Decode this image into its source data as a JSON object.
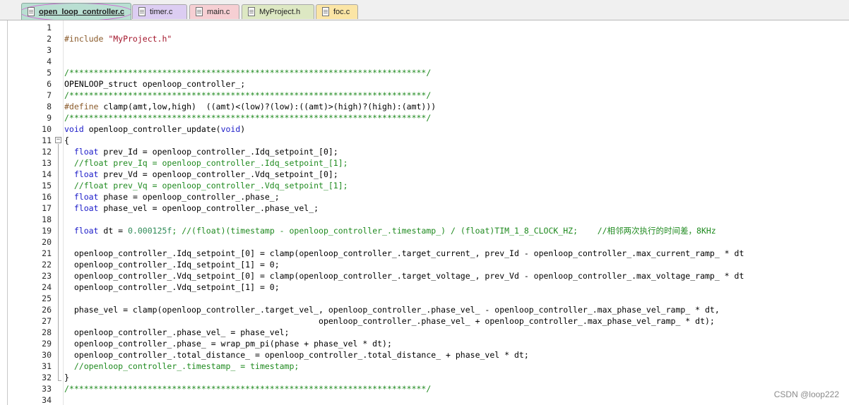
{
  "tabs": [
    {
      "label": "open_loop_controller.c",
      "active": true,
      "color": "#b9dfd2"
    },
    {
      "label": "timer.c",
      "active": false,
      "color": "#dccdf2"
    },
    {
      "label": "main.c",
      "active": false,
      "color": "#f6cfd3"
    },
    {
      "label": "MyProject.h",
      "active": false,
      "color": "#dde8c3"
    },
    {
      "label": "foc.c",
      "active": false,
      "color": "#fbe5a5"
    }
  ],
  "code_lines": [
    {
      "n": "1",
      "segments": []
    },
    {
      "n": "2",
      "segments": [
        {
          "t": "#include ",
          "c": "pre"
        },
        {
          "t": "\"MyProject.h\"",
          "c": "str"
        }
      ]
    },
    {
      "n": "3",
      "segments": []
    },
    {
      "n": "4",
      "segments": []
    },
    {
      "n": "5",
      "segments": [
        {
          "t": "/*************************************************************************/",
          "c": "com"
        }
      ]
    },
    {
      "n": "6",
      "segments": [
        {
          "t": "OPENLOOP_struct openloop_controller_;",
          "c": ""
        }
      ]
    },
    {
      "n": "7",
      "segments": [
        {
          "t": "/*************************************************************************/",
          "c": "com"
        }
      ]
    },
    {
      "n": "8",
      "segments": [
        {
          "t": "#define ",
          "c": "pre"
        },
        {
          "t": "clamp(amt,low,high)  ((amt)<(low)?(low):((amt)>(high)?(high):(amt)))",
          "c": ""
        }
      ]
    },
    {
      "n": "9",
      "segments": [
        {
          "t": "/*************************************************************************/",
          "c": "com"
        }
      ]
    },
    {
      "n": "10",
      "segments": [
        {
          "t": "void",
          "c": "kw"
        },
        {
          "t": " openloop_controller_update(",
          "c": ""
        },
        {
          "t": "void",
          "c": "kw"
        },
        {
          "t": ")",
          "c": ""
        }
      ]
    },
    {
      "n": "11",
      "segments": [
        {
          "t": "{",
          "c": ""
        }
      ]
    },
    {
      "n": "12",
      "segments": [
        {
          "t": "  ",
          "c": ""
        },
        {
          "t": "float",
          "c": "kw"
        },
        {
          "t": " prev_Id = openloop_controller_.Idq_setpoint_[0];",
          "c": ""
        }
      ]
    },
    {
      "n": "13",
      "segments": [
        {
          "t": "  //float prev_Iq = openloop_controller_.Idq_setpoint_[1];",
          "c": "com"
        }
      ]
    },
    {
      "n": "14",
      "segments": [
        {
          "t": "  ",
          "c": ""
        },
        {
          "t": "float",
          "c": "kw"
        },
        {
          "t": " prev_Vd = openloop_controller_.Vdq_setpoint_[0];",
          "c": ""
        }
      ]
    },
    {
      "n": "15",
      "segments": [
        {
          "t": "  //float prev_Vq = openloop_controller_.Vdq_setpoint_[1];",
          "c": "com"
        }
      ]
    },
    {
      "n": "16",
      "segments": [
        {
          "t": "  ",
          "c": ""
        },
        {
          "t": "float",
          "c": "kw"
        },
        {
          "t": " phase = openloop_controller_.phase_;",
          "c": ""
        }
      ]
    },
    {
      "n": "17",
      "segments": [
        {
          "t": "  ",
          "c": ""
        },
        {
          "t": "float",
          "c": "kw"
        },
        {
          "t": " phase_vel = openloop_controller_.phase_vel_;",
          "c": ""
        }
      ]
    },
    {
      "n": "18",
      "segments": []
    },
    {
      "n": "19",
      "segments": [
        {
          "t": "  ",
          "c": ""
        },
        {
          "t": "float",
          "c": "kw"
        },
        {
          "t": " dt = ",
          "c": ""
        },
        {
          "t": "0.000125f",
          "c": "num"
        },
        {
          "t": "; //(float)(timestamp - openloop_controller_.timestamp_) / (float)TIM_1_8_CLOCK_HZ;    //相邻两次执行的时间差，8KHz",
          "c": "com"
        }
      ]
    },
    {
      "n": "20",
      "segments": []
    },
    {
      "n": "21",
      "segments": [
        {
          "t": "  openloop_controller_.Idq_setpoint_[0] = clamp(openloop_controller_.target_current_, prev_Id - openloop_controller_.max_current_ramp_ * dt",
          "c": ""
        }
      ]
    },
    {
      "n": "22",
      "segments": [
        {
          "t": "  openloop_controller_.Idq_setpoint_[1] = 0;",
          "c": ""
        }
      ]
    },
    {
      "n": "23",
      "segments": [
        {
          "t": "  openloop_controller_.Vdq_setpoint_[0] = clamp(openloop_controller_.target_voltage_, prev_Vd - openloop_controller_.max_voltage_ramp_ * dt",
          "c": ""
        }
      ]
    },
    {
      "n": "24",
      "segments": [
        {
          "t": "  openloop_controller_.Vdq_setpoint_[1] = 0;",
          "c": ""
        }
      ]
    },
    {
      "n": "25",
      "segments": []
    },
    {
      "n": "26",
      "segments": [
        {
          "t": "  phase_vel = clamp(openloop_controller_.target_vel_, openloop_controller_.phase_vel_ - openloop_controller_.max_phase_vel_ramp_ * dt,",
          "c": ""
        }
      ]
    },
    {
      "n": "27",
      "segments": [
        {
          "t": "                                                    openloop_controller_.phase_vel_ + openloop_controller_.max_phase_vel_ramp_ * dt);",
          "c": ""
        }
      ]
    },
    {
      "n": "28",
      "segments": [
        {
          "t": "  openloop_controller_.phase_vel_ = phase_vel;",
          "c": ""
        }
      ]
    },
    {
      "n": "29",
      "segments": [
        {
          "t": "  openloop_controller_.phase_ = wrap_pm_pi(phase + phase_vel * dt);",
          "c": ""
        }
      ]
    },
    {
      "n": "30",
      "segments": [
        {
          "t": "  openloop_controller_.total_distance_ = openloop_controller_.total_distance_ + phase_vel * dt;",
          "c": ""
        }
      ]
    },
    {
      "n": "31",
      "segments": [
        {
          "t": "  //openloop_controller_.timestamp_ = timestamp;",
          "c": "com"
        }
      ]
    },
    {
      "n": "32",
      "segments": [
        {
          "t": "}",
          "c": ""
        }
      ]
    },
    {
      "n": "33",
      "segments": [
        {
          "t": "/*************************************************************************/",
          "c": "com"
        }
      ]
    },
    {
      "n": "34",
      "segments": []
    }
  ],
  "watermark": "CSDN @loop222",
  "fold_marker": "−",
  "icons": {
    "file": "file-icon",
    "fold": "fold-minus-icon"
  }
}
